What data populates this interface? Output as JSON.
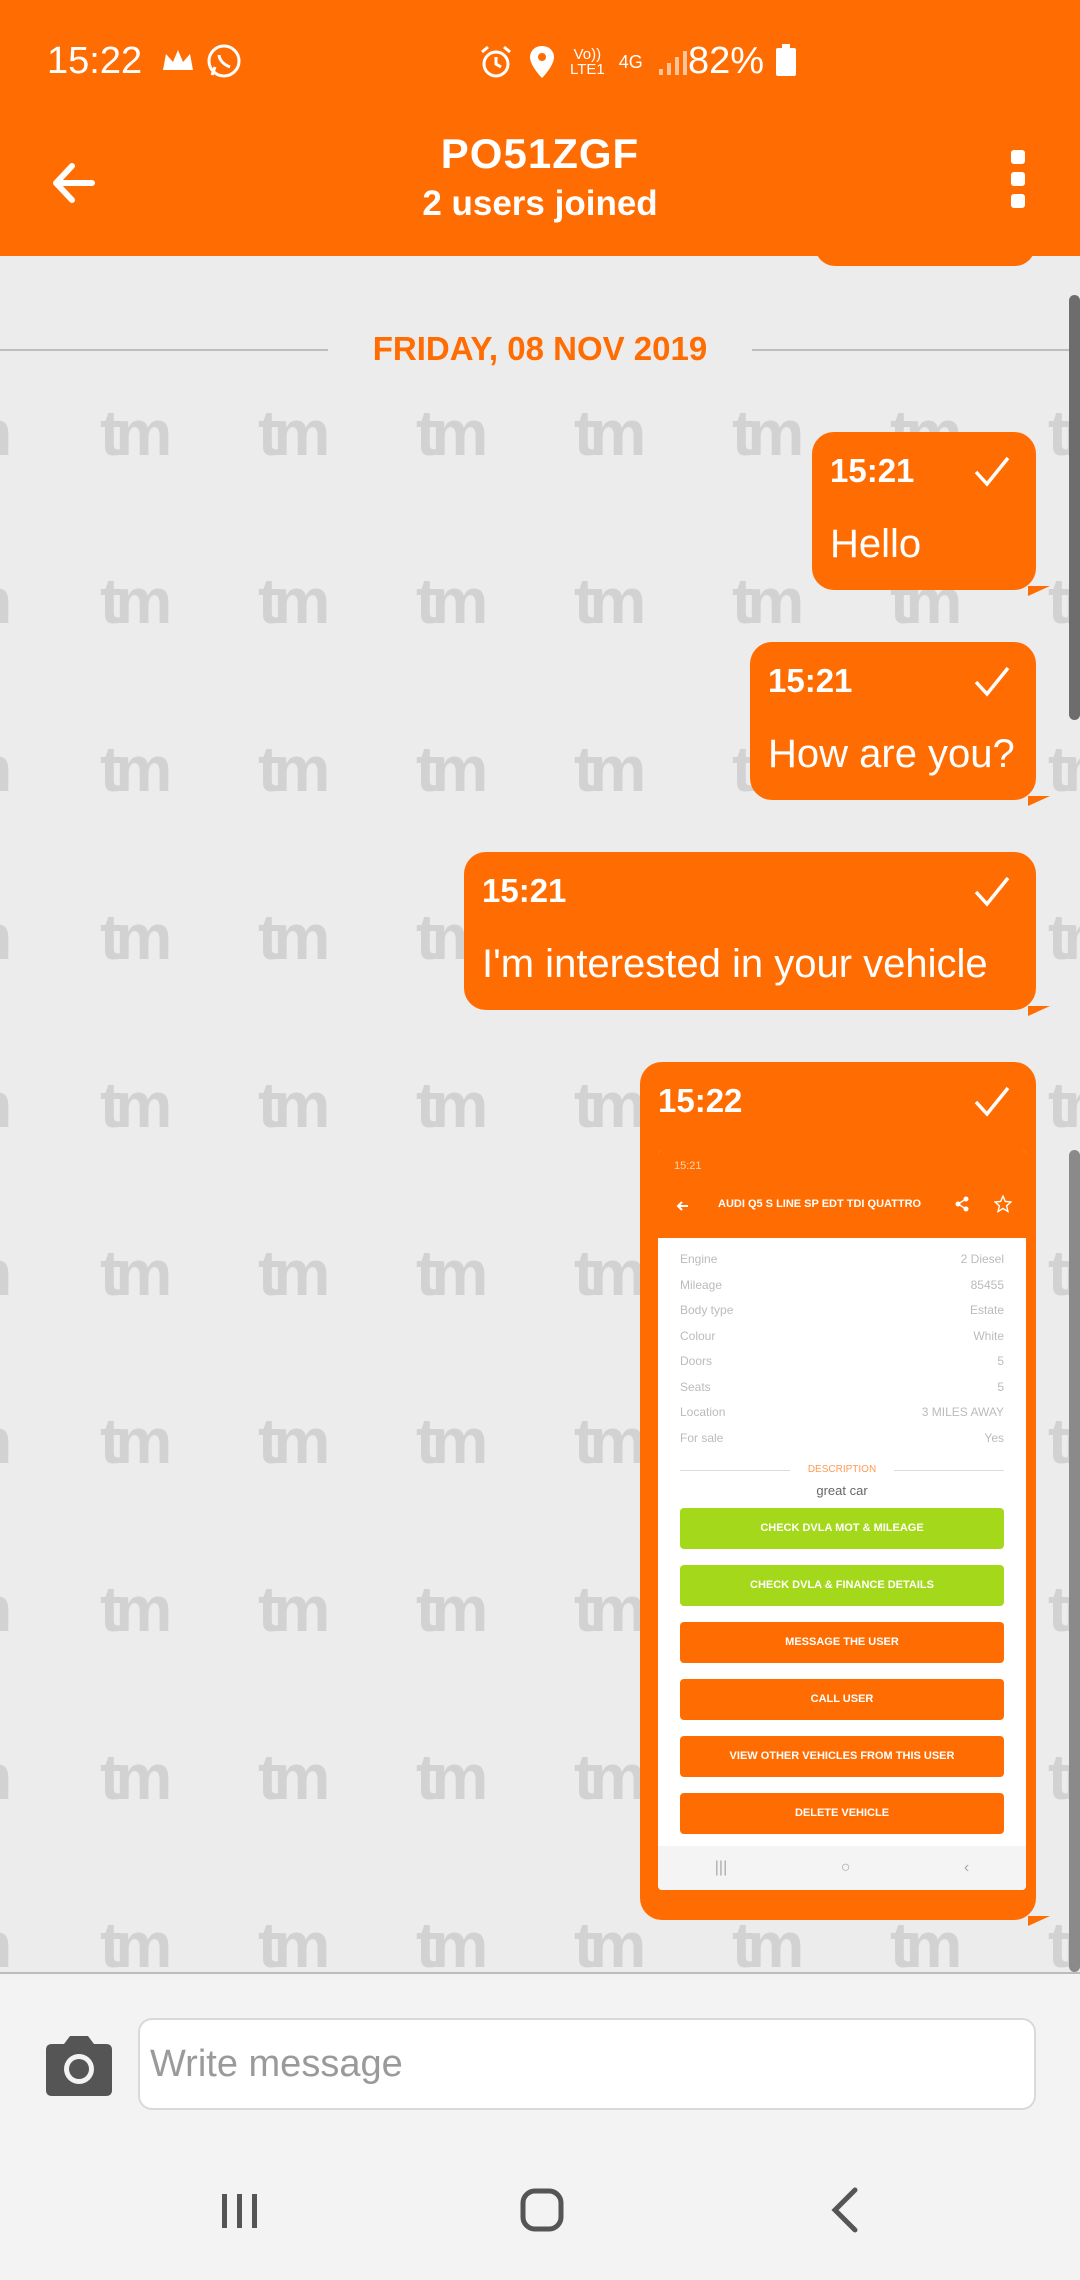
{
  "status_bar": {
    "time": "15:22",
    "network_volte": "Vo))\nLTE1",
    "network_4g": "4G",
    "battery": "82%"
  },
  "header": {
    "title": "PO51ZGF",
    "subtitle": "2 users joined"
  },
  "chat": {
    "date_separator": "FRIDAY, 08 NOV 2019",
    "watermark": "tm",
    "messages": [
      {
        "time": "15:21",
        "text": "Hello"
      },
      {
        "time": "15:21",
        "text": "How are you?"
      },
      {
        "time": "15:21",
        "text": "I'm interested in your vehicle"
      },
      {
        "time": "15:22",
        "text": ""
      }
    ],
    "attachment": {
      "status": "15:21",
      "title": "AUDI Q5 S LINE SP EDT TDI QUATTRO",
      "rows": [
        {
          "label": "Engine",
          "value": "2 Diesel"
        },
        {
          "label": "Mileage",
          "value": "85455"
        },
        {
          "label": "Body type",
          "value": "Estate"
        },
        {
          "label": "Colour",
          "value": "White"
        },
        {
          "label": "Doors",
          "value": "5"
        },
        {
          "label": "Seats",
          "value": "5"
        },
        {
          "label": "Location",
          "value": "3 MILES AWAY"
        },
        {
          "label": "For sale",
          "value": "Yes"
        }
      ],
      "description_label": "DESCRIPTION",
      "description": "great car",
      "buttons": [
        "CHECK DVLA MOT & MILEAGE",
        "CHECK DVLA & FINANCE DETAILS",
        "MESSAGE THE USER",
        "CALL USER",
        "VIEW OTHER VEHICLES FROM THIS USER",
        "DELETE VEHICLE"
      ]
    }
  },
  "composer": {
    "placeholder": "Write message"
  },
  "colors": {
    "accent": "#ff6c02",
    "green": "#a4d81a",
    "background": "#ececec"
  }
}
